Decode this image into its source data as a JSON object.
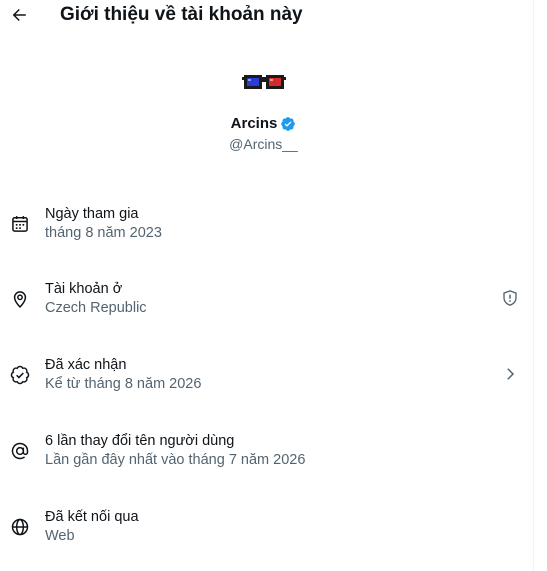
{
  "header": {
    "back_icon": "arrow-left-icon",
    "title": "Giới thiệu về tài khoản này"
  },
  "profile": {
    "avatar": "3d-glasses-avatar",
    "display_name": "Arcins",
    "verified_badge_icon": "verified-badge-icon",
    "verified_color": "#1d9bf0",
    "handle": "@Arcins__"
  },
  "rows": [
    {
      "icon": "calendar-icon",
      "title": "Ngày tham gia",
      "subtitle": "tháng 8 năm 2023"
    },
    {
      "icon": "location-pin-icon",
      "title": "Tài khoản ở",
      "subtitle": "Czech Republic",
      "trailing_icon": "shield-info-icon"
    },
    {
      "icon": "verified-check-icon",
      "title": "Đã xác nhận",
      "subtitle": "Kể từ tháng 8 năm 2026",
      "trailing_icon": "chevron-right-icon"
    },
    {
      "icon": "at-sign-icon",
      "title": "6 lần thay đổi tên người dùng",
      "subtitle": "Lần gần đây nhất vào tháng 7 năm 2026"
    },
    {
      "icon": "globe-icon",
      "title": "Đã kết nối qua",
      "subtitle": "Web"
    }
  ],
  "colors": {
    "text_primary": "#0f1419",
    "text_secondary": "#536471",
    "avatar_left_lens": "#2b3bd6",
    "avatar_right_lens": "#d62b2b"
  }
}
